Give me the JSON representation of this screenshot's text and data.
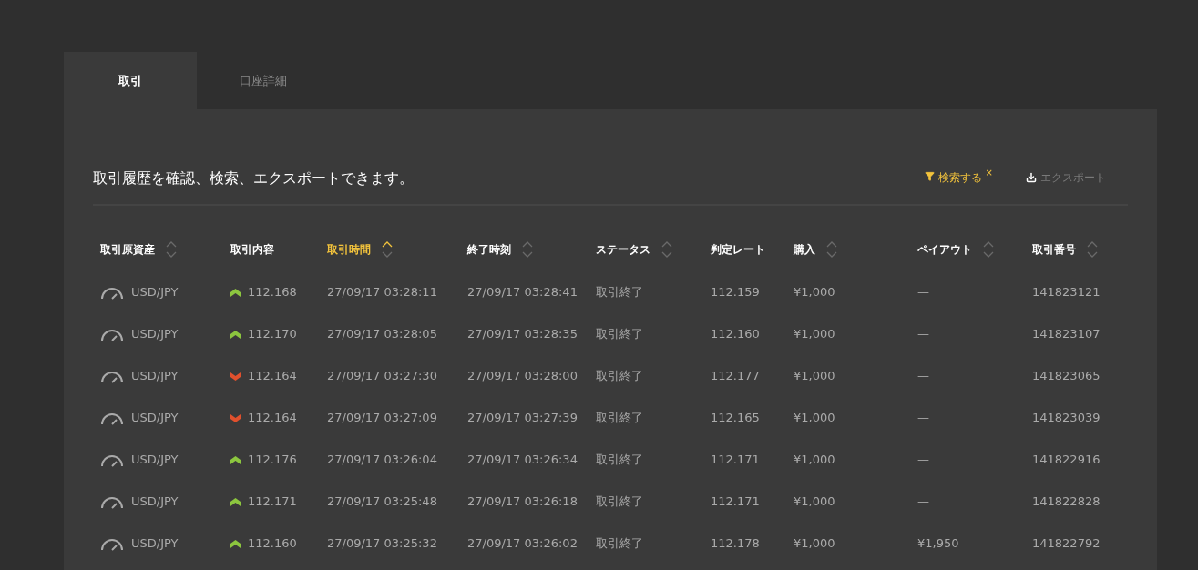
{
  "tabs": [
    {
      "label": "取引",
      "selected": true
    },
    {
      "label": "口座詳細",
      "selected": false
    }
  ],
  "description": "取引履歴を確認、検索、エクスポートできます。",
  "actions": {
    "search": {
      "label": "検索する",
      "clear": "×",
      "active": true
    },
    "export": {
      "label": "エクスポート"
    }
  },
  "table": {
    "columns": [
      {
        "label": "取引原資産",
        "sortable": true,
        "selected": false
      },
      {
        "label": "取引内容",
        "sortable": false,
        "selected": false
      },
      {
        "label": "取引時間",
        "sortable": true,
        "selected": true
      },
      {
        "label": "終了時刻",
        "sortable": true,
        "selected": false
      },
      {
        "label": "ステータス",
        "sortable": true,
        "selected": false
      },
      {
        "label": "判定レート",
        "sortable": false,
        "selected": false
      },
      {
        "label": "購入",
        "sortable": true,
        "selected": false
      },
      {
        "label": "ペイアウト",
        "sortable": true,
        "selected": false
      },
      {
        "label": "取引番号",
        "sortable": true,
        "selected": false
      }
    ],
    "rows": [
      {
        "asset": "USD/JPY",
        "kind": "up",
        "rate": "112.168",
        "time": "27/09/17 03:28:11",
        "end": "27/09/17 03:28:41",
        "status": "取引終了",
        "result_rate": "112.159",
        "purchase": "¥1,000",
        "payout": "—",
        "id": "141823121"
      },
      {
        "asset": "USD/JPY",
        "kind": "up",
        "rate": "112.170",
        "time": "27/09/17 03:28:05",
        "end": "27/09/17 03:28:35",
        "status": "取引終了",
        "result_rate": "112.160",
        "purchase": "¥1,000",
        "payout": "—",
        "id": "141823107"
      },
      {
        "asset": "USD/JPY",
        "kind": "down",
        "rate": "112.164",
        "time": "27/09/17 03:27:30",
        "end": "27/09/17 03:28:00",
        "status": "取引終了",
        "result_rate": "112.177",
        "purchase": "¥1,000",
        "payout": "—",
        "id": "141823065"
      },
      {
        "asset": "USD/JPY",
        "kind": "down",
        "rate": "112.164",
        "time": "27/09/17 03:27:09",
        "end": "27/09/17 03:27:39",
        "status": "取引終了",
        "result_rate": "112.165",
        "purchase": "¥1,000",
        "payout": "—",
        "id": "141823039"
      },
      {
        "asset": "USD/JPY",
        "kind": "up",
        "rate": "112.176",
        "time": "27/09/17 03:26:04",
        "end": "27/09/17 03:26:34",
        "status": "取引終了",
        "result_rate": "112.171",
        "purchase": "¥1,000",
        "payout": "—",
        "id": "141822916"
      },
      {
        "asset": "USD/JPY",
        "kind": "up",
        "rate": "112.171",
        "time": "27/09/17 03:25:48",
        "end": "27/09/17 03:26:18",
        "status": "取引終了",
        "result_rate": "112.171",
        "purchase": "¥1,000",
        "payout": "—",
        "id": "141822828"
      },
      {
        "asset": "USD/JPY",
        "kind": "up",
        "rate": "112.160",
        "time": "27/09/17 03:25:32",
        "end": "27/09/17 03:26:02",
        "status": "取引終了",
        "result_rate": "112.178",
        "purchase": "¥1,000",
        "payout": "¥1,950",
        "id": "141822792"
      }
    ]
  }
}
